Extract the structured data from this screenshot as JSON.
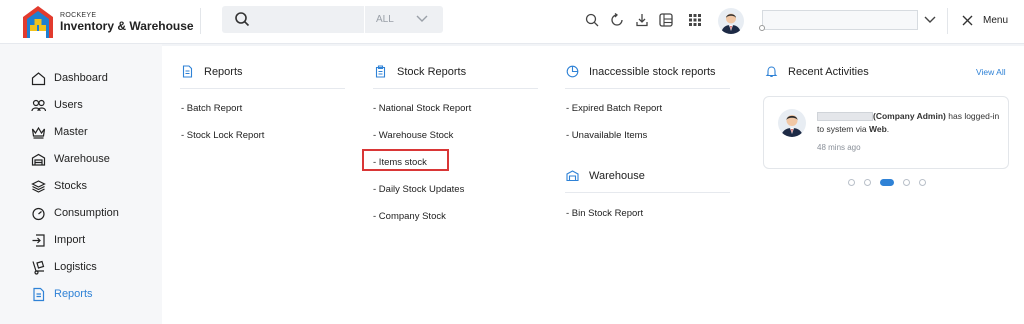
{
  "header": {
    "brand_small": "ROCKEYE",
    "brand_big": "Inventory & Warehouse",
    "search": {
      "placeholder": "",
      "scope": "ALL"
    },
    "menu_label": "Menu"
  },
  "sidebar": {
    "items": [
      {
        "label": "Dashboard",
        "icon": "home-icon"
      },
      {
        "label": "Users",
        "icon": "users-icon"
      },
      {
        "label": "Master",
        "icon": "crown-icon"
      },
      {
        "label": "Warehouse",
        "icon": "warehouse-icon"
      },
      {
        "label": "Stocks",
        "icon": "layers-icon"
      },
      {
        "label": "Consumption",
        "icon": "gauge-icon"
      },
      {
        "label": "Import",
        "icon": "import-icon"
      },
      {
        "label": "Logistics",
        "icon": "dolly-icon"
      },
      {
        "label": "Reports",
        "icon": "report-icon",
        "active": true
      }
    ]
  },
  "reports": {
    "title": "Reports",
    "links": [
      "- Batch Report",
      "- Stock Lock Report"
    ]
  },
  "stock_reports": {
    "title": "Stock Reports",
    "links": [
      "- National Stock Report",
      "- Warehouse Stock",
      "- Items stock",
      "- Daily Stock Updates",
      "- Company Stock"
    ]
  },
  "inaccessible": {
    "title": "Inaccessible stock reports",
    "links": [
      "- Expired Batch Report",
      "- Unavailable Items"
    ]
  },
  "warehouse": {
    "title": "Warehouse",
    "links": [
      "- Bin Stock Report"
    ]
  },
  "activities": {
    "title": "Recent Activities",
    "view_all": "View All",
    "role": "(Company Admin)",
    "message_a": " has logged-in to system via ",
    "via": "Web",
    "message_end": ".",
    "time": "48 mins ago"
  },
  "colors": {
    "accent": "#2f82d6",
    "highlight": "#d93636"
  }
}
